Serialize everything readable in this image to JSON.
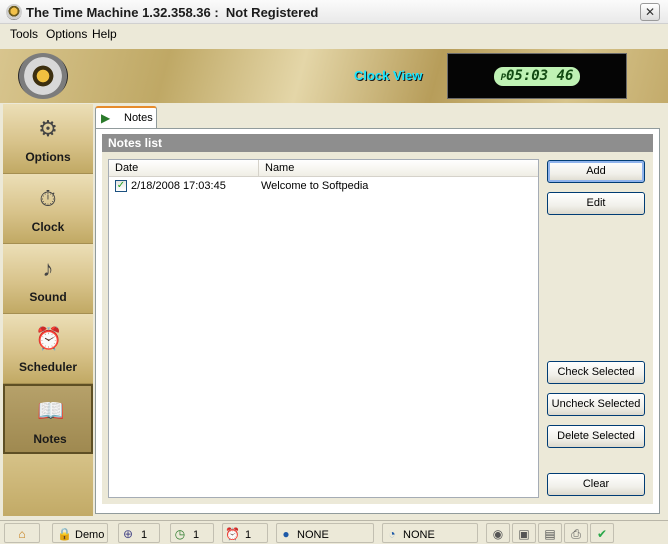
{
  "window": {
    "title": "The Time Machine 1.32.358.36 :  Not Registered",
    "close_glyph": "✕"
  },
  "menu": {
    "items": [
      {
        "label": "Tools"
      },
      {
        "label": "Options"
      },
      {
        "label": "Help"
      }
    ]
  },
  "header": {
    "clock_view_label": "Clock View",
    "clock_prefix": "P",
    "clock_time": "05:03 46"
  },
  "sidebar": {
    "items": [
      {
        "label": "Options",
        "icon": "gears-icon"
      },
      {
        "label": "Clock",
        "icon": "clock-icon"
      },
      {
        "label": "Sound",
        "icon": "speaker-icon"
      },
      {
        "label": "Scheduler",
        "icon": "scheduler-icon"
      },
      {
        "label": "Notes",
        "icon": "book-icon"
      }
    ],
    "active": "Notes"
  },
  "tabs": [
    {
      "label": "Notes",
      "active": true
    }
  ],
  "notes": {
    "header": "Notes list",
    "columns": [
      "Date",
      "Name"
    ],
    "rows": [
      {
        "checked": true,
        "date": "2/18/2008 17:03:45",
        "name": "Welcome to Softpedia"
      }
    ]
  },
  "buttons": {
    "add": "Add",
    "edit": "Edit",
    "check_selected": "Check Selected",
    "uncheck_selected": "Uncheck Selected",
    "delete_selected": "Delete Selected",
    "clear": "Clear"
  },
  "statusbar": {
    "mode": "Demo",
    "count1": "1",
    "count2": "1",
    "count3": "1",
    "net1": "NONE",
    "net2": "NONE"
  },
  "colors": {
    "clock_label": "#19e6ff",
    "lcd_background": "#bff2b4",
    "notes_header": "#8e8e8e",
    "gold": "#c3ab6b"
  }
}
